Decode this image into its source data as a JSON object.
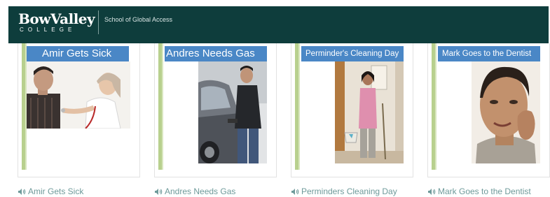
{
  "header": {
    "logo_main": "BowValley",
    "logo_sub": "COLLEGE",
    "tagline": "School of Global Access"
  },
  "books": [
    {
      "cover_title": "Amir Gets Sick",
      "link_label": "Amir Gets Sick"
    },
    {
      "cover_title": "Andres Needs Gas",
      "link_label": "Andres Needs Gas"
    },
    {
      "cover_title": "Perminder's Cleaning Day",
      "link_label": "Perminders Cleaning Day"
    },
    {
      "cover_title": "Mark Goes to the Dentist",
      "link_label": "Mark Goes to the Dentist"
    }
  ],
  "icons": {
    "audio": "speaker-icon"
  },
  "colors": {
    "header_bg": "#0e3d3c",
    "title_band": "#4a87c6",
    "link_text": "#6e9a9a",
    "spine_green": "#b8d08e"
  }
}
